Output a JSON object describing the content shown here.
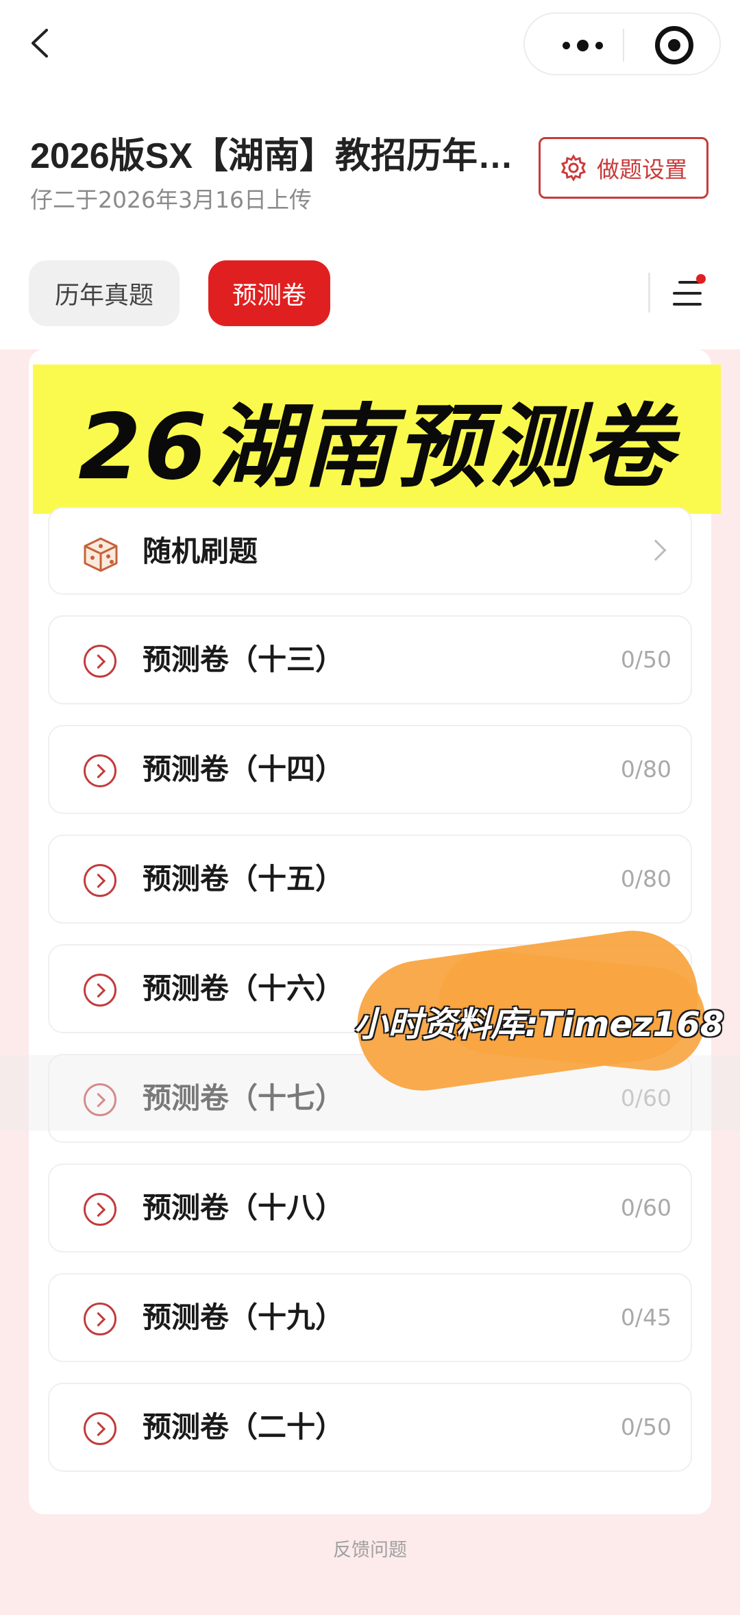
{
  "nav": {
    "back_icon": "chevron-left-icon",
    "more_icon": "more-dots-icon",
    "close_icon": "target-circle-icon"
  },
  "header": {
    "title": "2026版SX【湖南】教招历年…",
    "subtitle": "仔二于2026年3月16日上传",
    "settings_label": "做题设置"
  },
  "tabs": [
    {
      "label": "历年真题",
      "active": false
    },
    {
      "label": "预测卷",
      "active": true
    }
  ],
  "banner": {
    "text": "26湖南预测卷"
  },
  "random": {
    "label": "随机刷题"
  },
  "papers": [
    {
      "label": "预测卷（十三）",
      "count": "0/50"
    },
    {
      "label": "预测卷（十四）",
      "count": "0/80"
    },
    {
      "label": "预测卷（十五）",
      "count": "0/80"
    },
    {
      "label": "预测卷（十六）",
      "count": ""
    },
    {
      "label": "预测卷（十七）",
      "count": "0/60"
    },
    {
      "label": "预测卷（十八）",
      "count": "0/60"
    },
    {
      "label": "预测卷（十九）",
      "count": "0/45"
    },
    {
      "label": "预测卷（二十）",
      "count": "0/50"
    }
  ],
  "watermark": {
    "text": "小时资料库:Timez168"
  },
  "footer": {
    "feedback": "反馈问题"
  },
  "colors": {
    "accent": "#e02020",
    "banner_bg": "#fafa4e",
    "page_bg": "#fdeaea"
  }
}
